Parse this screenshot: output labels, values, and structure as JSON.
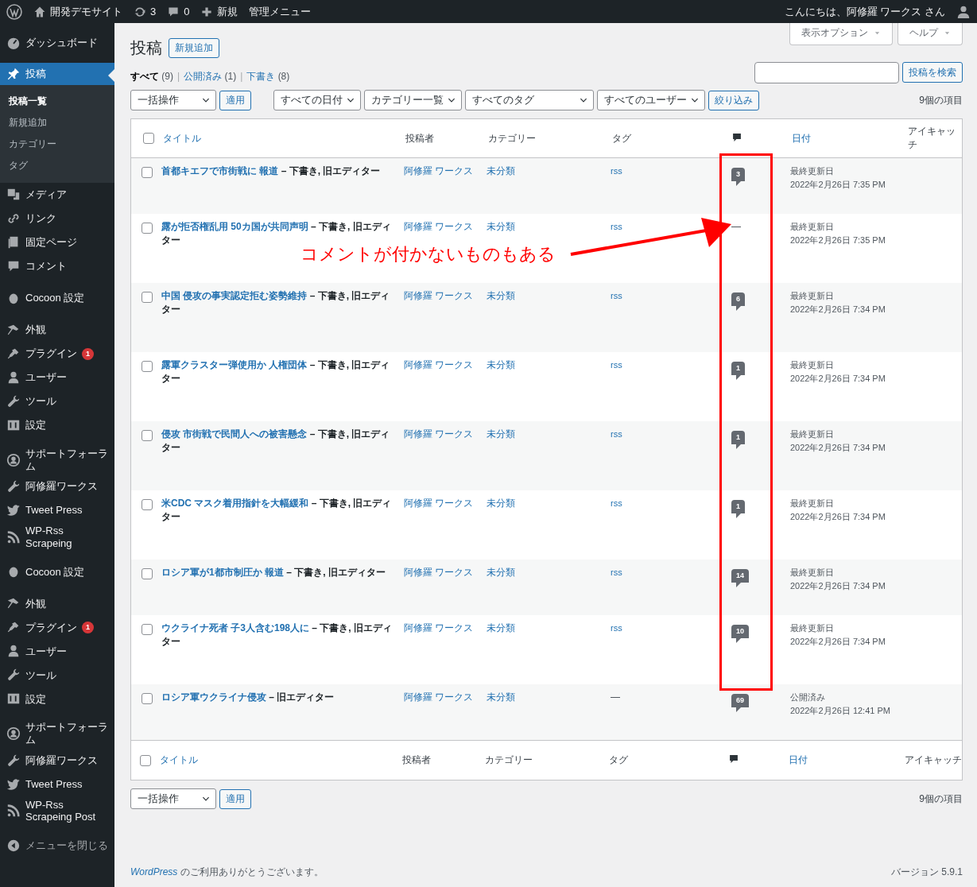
{
  "admin_bar": {
    "site": "開発デモサイト",
    "updates": "3",
    "comments": "0",
    "new": "新規",
    "admin_menu": "管理メニュー",
    "greeting": "こんにちは、阿修羅 ワークス さん"
  },
  "sidebar": {
    "groups": [
      [
        {
          "label": "ダッシュボード",
          "selected": false
        }
      ],
      [
        {
          "label": "投稿",
          "selected": true,
          "submenu": [
            {
              "label": "投稿一覧",
              "selected": true
            },
            {
              "label": "新規追加",
              "selected": false
            },
            {
              "label": "カテゴリー",
              "selected": false
            },
            {
              "label": "タグ",
              "selected": false
            }
          ]
        },
        {
          "label": "メディア",
          "selected": false
        },
        {
          "label": "リンク",
          "selected": false
        },
        {
          "label": "固定ページ",
          "selected": false
        },
        {
          "label": "コメント",
          "selected": false
        }
      ],
      [
        {
          "label": "Cocoon 設定",
          "selected": false
        }
      ],
      [
        {
          "label": "外観",
          "selected": false
        },
        {
          "label": "プラグイン",
          "selected": false,
          "badge": "1"
        },
        {
          "label": "ユーザー",
          "selected": false
        },
        {
          "label": "ツール",
          "selected": false
        },
        {
          "label": "設定",
          "selected": false
        }
      ],
      [
        {
          "label": "サポートフォーラム",
          "selected": false
        },
        {
          "label": "阿修羅ワークス",
          "selected": false
        },
        {
          "label": "Tweet Press",
          "selected": false
        },
        {
          "label": "WP-Rss Scrapeing",
          "selected": false
        }
      ],
      [
        {
          "label": "Cocoon 設定",
          "selected": false
        }
      ],
      [
        {
          "label": "外観",
          "selected": false
        },
        {
          "label": "プラグイン",
          "selected": false,
          "badge": "1"
        },
        {
          "label": "ユーザー",
          "selected": false
        },
        {
          "label": "ツール",
          "selected": false
        },
        {
          "label": "設定",
          "selected": false
        }
      ],
      [
        {
          "label": "サポートフォーラム",
          "selected": false
        },
        {
          "label": "阿修羅ワークス",
          "selected": false
        },
        {
          "label": "Tweet Press",
          "selected": false
        },
        {
          "label": "WP-Rss Scrapeing Post",
          "selected": false
        }
      ]
    ],
    "collapse": "メニューを閉じる"
  },
  "screen_meta": [
    "表示オプション",
    "ヘルプ"
  ],
  "heading": "投稿",
  "add_new": "新規追加",
  "views": {
    "items": [
      {
        "label": "すべて",
        "count": "(9)",
        "selected": true
      },
      {
        "label": "公開済み",
        "count": "(1)",
        "selected": false
      },
      {
        "label": "下書き",
        "count": "(8)",
        "selected": false
      }
    ],
    "separators": [
      "|",
      "|"
    ]
  },
  "search": {
    "button": "投稿を検索"
  },
  "filters": {
    "bulk": "一括操作",
    "apply": "適用",
    "selects": [
      "すべての日付",
      "カテゴリー一覧",
      "すべてのタグ",
      "すべてのユーザー"
    ],
    "filter": "絞り込み",
    "count": "9個の項目"
  },
  "table": {
    "header": {
      "checked": false,
      "columns": [
        "タイトル",
        "投稿者",
        "カテゴリー",
        "タグ",
        "日付",
        "アイキャッチ"
      ]
    },
    "rows": [
      {
        "checked": false,
        "title": "首都キエフで市街戦に 報道",
        "state": " – 下書き, 旧エディター",
        "author": "阿修羅 ワークス",
        "category": "未分類",
        "tag": {
          "kind": "link",
          "text": "rss"
        },
        "comments": {
          "kind": "count",
          "text": "3"
        },
        "date_label": "最終更新日",
        "date": "2022年2月26日 7:35 PM"
      },
      {
        "checked": false,
        "title": "露が拒否権乱用 50カ国が共同声明",
        "state": " – 下書き, 旧エディター",
        "author": "阿修羅 ワークス",
        "category": "未分類",
        "tag": {
          "kind": "link",
          "text": "rss"
        },
        "comments": {
          "kind": "none",
          "text": "—"
        },
        "date_label": "最終更新日",
        "date": "2022年2月26日 7:35 PM"
      },
      {
        "checked": false,
        "title": "中国 侵攻の事実認定拒む姿勢維持",
        "state": " – 下書き, 旧エディター",
        "author": "阿修羅 ワークス",
        "category": "未分類",
        "tag": {
          "kind": "link",
          "text": "rss"
        },
        "comments": {
          "kind": "count",
          "text": "6"
        },
        "date_label": "最終更新日",
        "date": "2022年2月26日 7:34 PM"
      },
      {
        "checked": false,
        "title": "露軍クラスター弾使用か 人権団体",
        "state": " – 下書き, 旧エディター",
        "author": "阿修羅 ワークス",
        "category": "未分類",
        "tag": {
          "kind": "link",
          "text": "rss"
        },
        "comments": {
          "kind": "count",
          "text": "1"
        },
        "date_label": "最終更新日",
        "date": "2022年2月26日 7:34 PM"
      },
      {
        "checked": false,
        "title": "侵攻 市街戦で民間人への被害懸念",
        "state": " – 下書き, 旧エディター",
        "author": "阿修羅 ワークス",
        "category": "未分類",
        "tag": {
          "kind": "link",
          "text": "rss"
        },
        "comments": {
          "kind": "count",
          "text": "1"
        },
        "date_label": "最終更新日",
        "date": "2022年2月26日 7:34 PM"
      },
      {
        "checked": false,
        "title": "米CDC マスク着用指針を大幅緩和",
        "state": " – 下書き, 旧エディター",
        "author": "阿修羅 ワークス",
        "category": "未分類",
        "tag": {
          "kind": "link",
          "text": "rss"
        },
        "comments": {
          "kind": "count",
          "text": "1"
        },
        "date_label": "最終更新日",
        "date": "2022年2月26日 7:34 PM"
      },
      {
        "checked": false,
        "title": "ロシア軍が1都市制圧か 報道",
        "state": " – 下書き, 旧エディター",
        "author": "阿修羅 ワークス",
        "category": "未分類",
        "tag": {
          "kind": "link",
          "text": "rss"
        },
        "comments": {
          "kind": "count",
          "text": "14"
        },
        "date_label": "最終更新日",
        "date": "2022年2月26日 7:34 PM"
      },
      {
        "checked": false,
        "title": "ウクライナ死者 子3人含む198人に",
        "state": " – 下書き, 旧エディター",
        "author": "阿修羅 ワークス",
        "category": "未分類",
        "tag": {
          "kind": "link",
          "text": "rss"
        },
        "comments": {
          "kind": "count",
          "text": "10"
        },
        "date_label": "最終更新日",
        "date": "2022年2月26日 7:34 PM"
      },
      {
        "checked": false,
        "title": "ロシア軍ウクライナ侵攻",
        "state": " – 旧エディター",
        "author": "阿修羅 ワークス",
        "category": "未分類",
        "tag": {
          "kind": "none",
          "text": "—"
        },
        "comments": {
          "kind": "count",
          "text": "69"
        },
        "date_label": "公開済み",
        "date": "2022年2月26日 12:41 PM"
      }
    ],
    "footer": {
      "checked": false,
      "columns": [
        "タイトル",
        "投稿者",
        "カテゴリー",
        "タグ",
        "日付",
        "アイキャッチ"
      ]
    }
  },
  "bottom": {
    "bulk": "一括操作",
    "apply": "適用",
    "count": "9個の項目"
  },
  "footer": {
    "link": "WordPress",
    "text": " のご利用ありがとうございます。",
    "version": "バージョン 5.9.1"
  },
  "annotation": {
    "text": "コメントが付かないものもある"
  }
}
